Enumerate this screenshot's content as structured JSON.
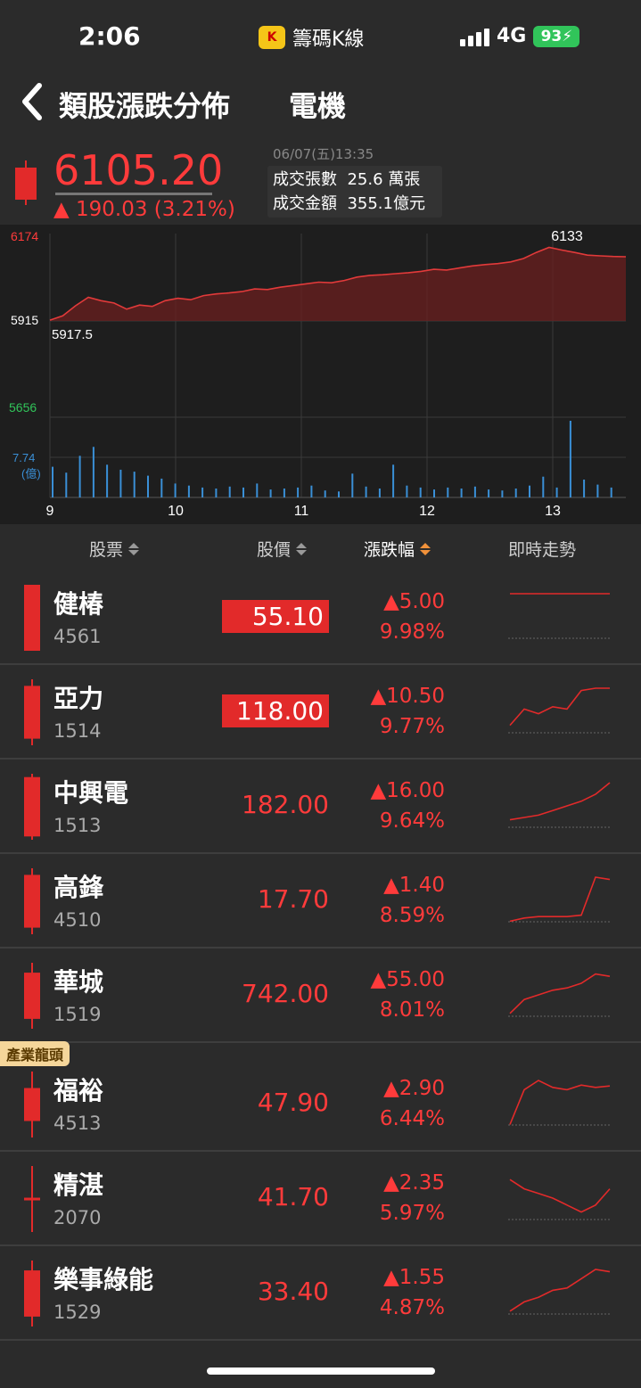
{
  "status_bar": {
    "time": "2:06",
    "app_label": "籌碼K線",
    "network": "4G",
    "battery": "93"
  },
  "nav": {
    "title": "類股漲跌分佈",
    "subtitle": "電機"
  },
  "summary": {
    "price": "6105.20",
    "change": "▲ 190.03 (3.21%)",
    "date": "06/07(五)13:35",
    "volume_label": "成交張數",
    "volume_value": "25.6 萬張",
    "amount_label": "成交金額",
    "amount_value": "355.1億元"
  },
  "colors": {
    "up": "#ff3b3b",
    "down": "#31c45a",
    "volume": "#3a8fd6",
    "sort_active": "#f0913a"
  },
  "chart_data": {
    "type": "line",
    "y_ticks": [
      "6174",
      "5915",
      "5656"
    ],
    "y_range": [
      5656,
      6174
    ],
    "reference": 5915,
    "open_label": "5917.5",
    "high_label": "6133",
    "volume_max_label": "7.74",
    "volume_unit": "(億)",
    "x_ticks": [
      "9",
      "10",
      "11",
      "12",
      "13"
    ],
    "price": [
      5917.5,
      5930,
      5960,
      5985,
      5975,
      5968,
      5950,
      5962,
      5958,
      5975,
      5982,
      5978,
      5990,
      5995,
      5998,
      6002,
      6010,
      6008,
      6015,
      6020,
      6025,
      6030,
      6028,
      6035,
      6045,
      6050,
      6052,
      6055,
      6058,
      6062,
      6068,
      6066,
      6072,
      6078,
      6082,
      6085,
      6090,
      6100,
      6118,
      6133,
      6125,
      6118,
      6110,
      6108,
      6106,
      6105.2
    ],
    "volume": [
      3.1,
      2.5,
      4.2,
      5.1,
      3.3,
      2.8,
      2.6,
      2.2,
      1.9,
      1.4,
      1.2,
      1.0,
      0.9,
      1.1,
      1.0,
      1.4,
      0.8,
      0.9,
      1.0,
      1.2,
      0.7,
      0.6,
      2.4,
      1.1,
      0.9,
      3.3,
      1.2,
      1.0,
      0.8,
      1.0,
      0.9,
      1.1,
      0.8,
      0.7,
      0.9,
      1.2,
      2.1,
      1.0,
      7.74,
      1.8,
      1.3,
      1.0
    ]
  },
  "table": {
    "headers": {
      "stock": "股票",
      "price": "股價",
      "change": "漲跌幅",
      "trend": "即時走勢"
    },
    "rows": [
      {
        "name": "健椿",
        "code": "4561",
        "price": "55.10",
        "change": "▲5.00",
        "pct": "9.98%",
        "limit": true,
        "candle": {
          "hi": 0.0,
          "lo": 1.0,
          "open": 0.0,
          "close": 1.0
        },
        "spark": [
          1,
          1,
          1,
          1,
          1,
          1,
          1,
          1
        ]
      },
      {
        "name": "亞力",
        "code": "1514",
        "price": "118.00",
        "change": "▲10.50",
        "pct": "9.77%",
        "limit": true,
        "candle": {
          "hi": 0.0,
          "lo": 1.0,
          "open": 0.1,
          "close": 0.9
        },
        "spark": [
          0.2,
          0.55,
          0.45,
          0.6,
          0.55,
          0.95,
          1,
          1
        ]
      },
      {
        "name": "中興電",
        "code": "1513",
        "price": "182.00",
        "change": "▲16.00",
        "pct": "9.64%",
        "limit": false,
        "candle": {
          "hi": 0.0,
          "lo": 1.0,
          "open": 0.05,
          "close": 0.95
        },
        "spark": [
          0.2,
          0.25,
          0.3,
          0.4,
          0.5,
          0.6,
          0.75,
          1
        ]
      },
      {
        "name": "高鋒",
        "code": "4510",
        "price": "17.70",
        "change": "▲1.40",
        "pct": "8.59%",
        "limit": false,
        "candle": {
          "hi": 0.0,
          "lo": 1.0,
          "open": 0.1,
          "close": 0.9
        },
        "spark": [
          0.05,
          0.12,
          0.15,
          0.15,
          0.15,
          0.18,
          1,
          0.95
        ]
      },
      {
        "name": "華城",
        "code": "1519",
        "price": "742.00",
        "change": "▲55.00",
        "pct": "8.01%",
        "limit": false,
        "candle": {
          "hi": 0.0,
          "lo": 1.0,
          "open": 0.15,
          "close": 0.85
        },
        "spark": [
          0.1,
          0.4,
          0.5,
          0.6,
          0.65,
          0.75,
          0.95,
          0.9
        ]
      },
      {
        "name": "福裕",
        "code": "4513",
        "price": "47.90",
        "change": "▲2.90",
        "pct": "6.44%",
        "limit": false,
        "leader": "產業龍頭",
        "candle": {
          "hi": 0.0,
          "lo": 1.0,
          "open": 0.25,
          "close": 0.75
        },
        "spark": [
          0.05,
          0.8,
          1,
          0.85,
          0.8,
          0.9,
          0.85,
          0.88
        ]
      },
      {
        "name": "精湛",
        "code": "2070",
        "price": "41.70",
        "change": "▲2.35",
        "pct": "5.97%",
        "limit": false,
        "candle": {
          "hi": 0.0,
          "lo": 1.0,
          "open": 0.48,
          "close": 0.52
        },
        "spark": [
          0.9,
          0.7,
          0.6,
          0.5,
          0.35,
          0.2,
          0.35,
          0.7
        ]
      },
      {
        "name": "樂事綠能",
        "code": "1529",
        "price": "33.40",
        "change": "▲1.55",
        "pct": "4.87%",
        "limit": false,
        "candle": {
          "hi": 0.0,
          "lo": 1.0,
          "open": 0.15,
          "close": 0.85
        },
        "spark": [
          0.1,
          0.3,
          0.4,
          0.55,
          0.6,
          0.8,
          1,
          0.95
        ]
      }
    ]
  }
}
